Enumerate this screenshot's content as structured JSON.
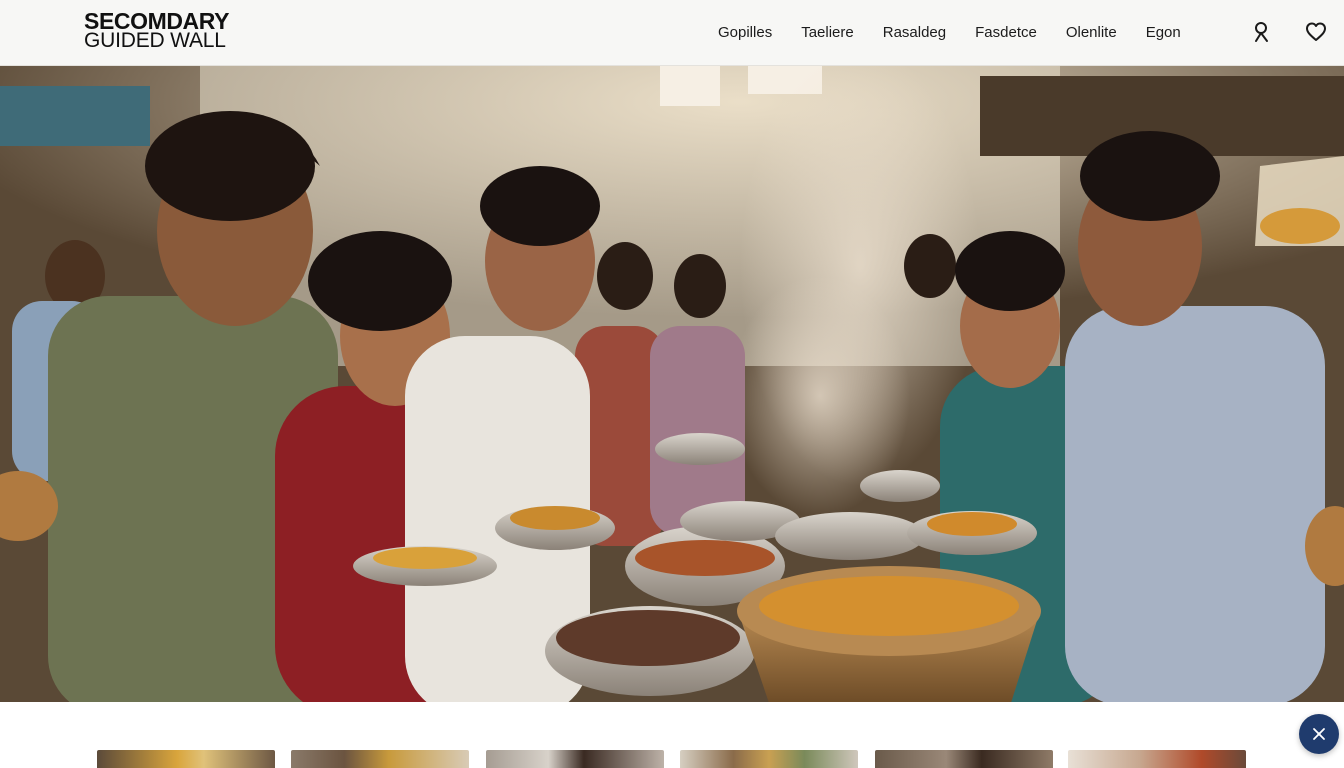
{
  "brand": {
    "line1": "SECOMDARY",
    "line2": "GUIDED WALL"
  },
  "nav": {
    "items": [
      {
        "label": "Gopilles"
      },
      {
        "label": "Taeliere"
      },
      {
        "label": "Rasaldeg"
      },
      {
        "label": "Fasdetce"
      },
      {
        "label": "Olenlite"
      },
      {
        "label": "Egon"
      }
    ]
  },
  "icons": {
    "search": "search-icon",
    "favorites": "heart-icon",
    "assist": "sparkle-close-icon"
  },
  "hero": {
    "scene": "street-food-tasting-photo"
  },
  "thumbnails": {
    "count_visible": 6
  },
  "colors": {
    "header_bg": "#f7f7f5",
    "text": "#1c1c1c",
    "fab_bg": "#1f3b6d"
  }
}
